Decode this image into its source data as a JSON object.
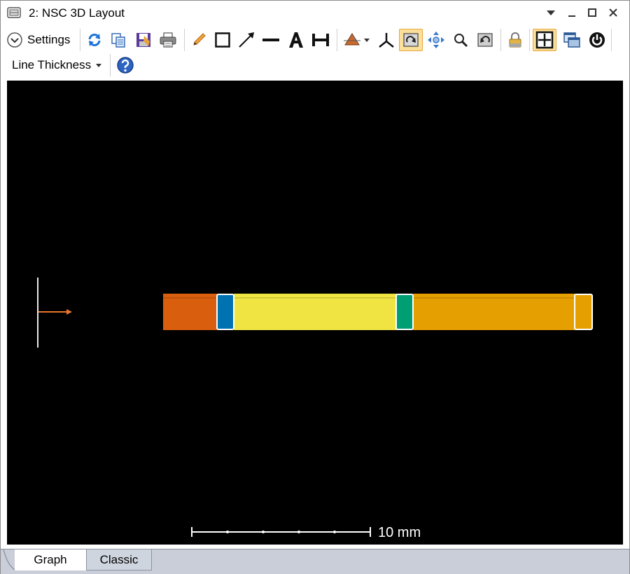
{
  "window": {
    "title": "2: NSC 3D Layout"
  },
  "toolbar": {
    "settings_label": "Settings",
    "line_thickness_label": "Line Thickness",
    "buttons": [
      "refresh-icon",
      "copy-icon",
      "save-icon",
      "print-icon",
      "pencil-icon",
      "rectangle-icon",
      "arrow-icon",
      "line-icon",
      "text-icon",
      "dimension-icon",
      "rotate-view-icon",
      "axes-icon",
      "rotate-active-icon",
      "pan-icon",
      "zoom-icon",
      "reset-view-icon",
      "lock-icon",
      "fit-window-icon",
      "float-window-icon",
      "power-icon",
      "help-icon"
    ]
  },
  "layout": {
    "scale_label": "10 mm",
    "colors": {
      "background": "#000000",
      "segment_1": "#d95f0e",
      "lens_1": "#0072b2",
      "segment_2": "#f0e442",
      "lens_2": "#009e73",
      "segment_3": "#e69f00",
      "end_cap": "#e69f00",
      "outline": "#ffffff",
      "source_ray": "#e8762a"
    }
  },
  "tabs": {
    "graph": "Graph",
    "classic": "Classic"
  }
}
